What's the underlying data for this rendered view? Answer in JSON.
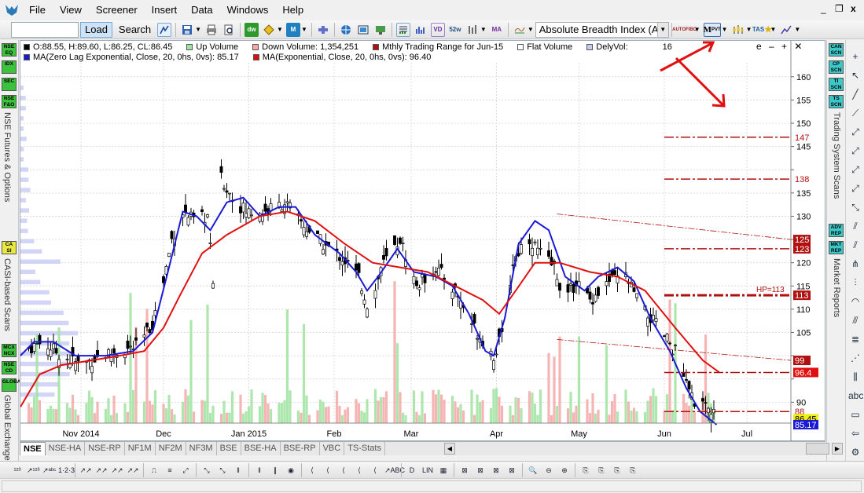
{
  "menu": {
    "items": [
      "File",
      "View",
      "Screener",
      "Insert",
      "Data",
      "Windows",
      "Help"
    ],
    "minimize": "_",
    "restore": "❐",
    "close": "x"
  },
  "toolbar": {
    "symbol_value": "",
    "load_label": "Load",
    "search_label": "Search",
    "indicator_value": "Absolute Breadth Index (ABI",
    "icons": {
      "dw": "dw",
      "s52": "52w",
      "hilo": "HiLo",
      "ma": "MA",
      "auto": "AUTO",
      "fibo": "FIBO",
      "mpvt_m": "M",
      "mpvt": "PVT",
      "tas": "TAS"
    }
  },
  "left_panel": {
    "badges": [
      "NSE EQ",
      "IDX",
      "SEC",
      "NSE F&O",
      "CA SI",
      "MCX NCX",
      "NSE CD",
      "GLOBAL"
    ],
    "labels": [
      "NSE Futures & Options",
      "CASI-based Scans",
      "Global Exchange"
    ]
  },
  "right_panel": {
    "badges": [
      "CAN SCN",
      "CP SCN",
      "TI SCN",
      "TS SCN",
      "ADV REP",
      "MKT REP"
    ],
    "labels": [
      "Trading System Scans",
      "Market Reports"
    ]
  },
  "legend": {
    "ohlc": "O:88.55, H:89.60, L:86.25, CL:86.45",
    "up_volume": "Up Volume",
    "down_volume": "Down Volume: 1,354,251",
    "monthly_range": "Mthly Trading Range for Jun-15",
    "flat_volume": "Flat Volume",
    "dely_vol": "DelyVol:",
    "dely_vol_value": "16",
    "ma1": "MA(Zero Lag Exponential, Close, 20, 0hs, 0vs): 85.17",
    "ma2": "MA(Exponential, Close, 20, 0hs, 0vs): 96.40",
    "controls": "e – + ✕"
  },
  "colors": {
    "candle": "#000000",
    "ma_blue": "#1a1ad6",
    "ma_red": "#e01010",
    "level_line": "#b01010",
    "up_vol": "#9fe39f",
    "down_vol": "#f4a8a8",
    "vap": "#c8caf4",
    "badge_green": "#3cc23c",
    "badge_cyan": "#3cc8c8",
    "badge_yellow": "#e8e840",
    "price_tag_bg": "#b01010",
    "close_tag_bg": "#f2ee10",
    "zl_tag_bg": "#1a1ad6"
  },
  "chart_data": {
    "type": "candlestick",
    "title": "",
    "y_ticks": [
      90,
      95,
      100,
      105,
      110,
      115,
      120,
      125,
      130,
      135,
      140,
      145,
      150,
      155,
      160
    ],
    "y_tick_labels_shown": [
      "90",
      "",
      "",
      "105",
      "110",
      "115",
      "120",
      "125",
      "130",
      "135",
      "",
      "145",
      "150",
      "155",
      "160"
    ],
    "ylim": [
      85.5,
      163
    ],
    "x_labels": [
      "Nov 2014",
      "Dec",
      "Jan 2015",
      "Feb",
      "Mar",
      "Apr",
      "May",
      "Jun",
      "Jul"
    ],
    "x_label_dates": [
      "2014-11-01",
      "2014-12-01",
      "2015-01-01",
      "2015-02-01",
      "2015-03-01",
      "2015-04-01",
      "2015-05-01",
      "2015-06-01",
      "2015-07-01"
    ],
    "xlim": [
      "2014-10-10",
      "2015-07-17"
    ],
    "close_path": [
      [
        "2014-10-11",
        101
      ],
      [
        "2014-10-18",
        103
      ],
      [
        "2014-10-25",
        100
      ],
      [
        "2014-11-01",
        98
      ],
      [
        "2014-11-08",
        100
      ],
      [
        "2014-11-15",
        101
      ],
      [
        "2014-11-22",
        102
      ],
      [
        "2014-11-27",
        107
      ],
      [
        "2014-12-01",
        116
      ],
      [
        "2014-12-04",
        125
      ],
      [
        "2014-12-08",
        131
      ],
      [
        "2014-12-12",
        129
      ],
      [
        "2014-12-17",
        130
      ],
      [
        "2014-12-19",
        116
      ],
      [
        "2014-12-22",
        138
      ],
      [
        "2014-12-26",
        134
      ],
      [
        "2014-12-31",
        131
      ],
      [
        "2015-01-07",
        131
      ],
      [
        "2015-01-14",
        133
      ],
      [
        "2015-01-21",
        128
      ],
      [
        "2015-01-28",
        124
      ],
      [
        "2015-02-04",
        121
      ],
      [
        "2015-02-10",
        117
      ],
      [
        "2015-02-14",
        109
      ],
      [
        "2015-02-18",
        119
      ],
      [
        "2015-02-25",
        125
      ],
      [
        "2015-03-03",
        115
      ],
      [
        "2015-03-10",
        119
      ],
      [
        "2015-03-17",
        114
      ],
      [
        "2015-03-24",
        106
      ],
      [
        "2015-03-31",
        100
      ],
      [
        "2015-04-03",
        104
      ],
      [
        "2015-04-07",
        120
      ],
      [
        "2015-04-12",
        126
      ],
      [
        "2015-04-17",
        122
      ],
      [
        "2015-04-22",
        119
      ],
      [
        "2015-04-26",
        112
      ],
      [
        "2015-04-30",
        116
      ],
      [
        "2015-05-05",
        112
      ],
      [
        "2015-05-12",
        116
      ],
      [
        "2015-05-18",
        117
      ],
      [
        "2015-05-24",
        110
      ],
      [
        "2015-05-30",
        106
      ],
      [
        "2015-06-05",
        101
      ],
      [
        "2015-06-10",
        92
      ],
      [
        "2015-06-14",
        89
      ],
      [
        "2015-06-18",
        88
      ],
      [
        "2015-06-21",
        86.45
      ]
    ],
    "series": [
      {
        "name": "MA(Zero Lag Exponential, Close, 20, 0hs, 0vs)",
        "last": 85.17,
        "points": [
          [
            "2014-10-10",
            100
          ],
          [
            "2014-10-15",
            103
          ],
          [
            "2014-10-22",
            103
          ],
          [
            "2014-10-30",
            100
          ],
          [
            "2014-11-10",
            100
          ],
          [
            "2014-11-20",
            101
          ],
          [
            "2014-11-27",
            105
          ],
          [
            "2014-12-03",
            119
          ],
          [
            "2014-12-08",
            131
          ],
          [
            "2014-12-13",
            130
          ],
          [
            "2014-12-18",
            127
          ],
          [
            "2014-12-24",
            133
          ],
          [
            "2014-12-30",
            134
          ],
          [
            "2015-01-05",
            130
          ],
          [
            "2015-01-12",
            132
          ],
          [
            "2015-01-18",
            132
          ],
          [
            "2015-01-25",
            126
          ],
          [
            "2015-02-03",
            122
          ],
          [
            "2015-02-09",
            118
          ],
          [
            "2015-02-13",
            114
          ],
          [
            "2015-02-17",
            117
          ],
          [
            "2015-02-24",
            123
          ],
          [
            "2015-03-02",
            118
          ],
          [
            "2015-03-10",
            117
          ],
          [
            "2015-03-16",
            115
          ],
          [
            "2015-03-22",
            109
          ],
          [
            "2015-03-28",
            101
          ],
          [
            "2015-03-31",
            100
          ],
          [
            "2015-04-04",
            108
          ],
          [
            "2015-04-09",
            124
          ],
          [
            "2015-04-15",
            129
          ],
          [
            "2015-04-20",
            127
          ],
          [
            "2015-04-26",
            117
          ],
          [
            "2015-05-03",
            114
          ],
          [
            "2015-05-08",
            117
          ],
          [
            "2015-05-15",
            119
          ],
          [
            "2015-05-21",
            116
          ],
          [
            "2015-05-27",
            108
          ],
          [
            "2015-06-03",
            101
          ],
          [
            "2015-06-09",
            93
          ],
          [
            "2015-06-14",
            88
          ],
          [
            "2015-06-20",
            85.17
          ]
        ]
      },
      {
        "name": "MA(Exponential, Close, 20, 0hs, 0vs)",
        "last": 96.4,
        "points": [
          [
            "2014-10-10",
            89
          ],
          [
            "2014-10-17",
            96
          ],
          [
            "2014-10-25",
            98
          ],
          [
            "2014-11-05",
            99
          ],
          [
            "2014-11-15",
            100
          ],
          [
            "2014-11-24",
            101
          ],
          [
            "2014-12-01",
            106
          ],
          [
            "2014-12-07",
            113
          ],
          [
            "2014-12-15",
            122
          ],
          [
            "2014-12-24",
            126
          ],
          [
            "2015-01-05",
            130
          ],
          [
            "2015-01-15",
            131
          ],
          [
            "2015-01-25",
            129
          ],
          [
            "2015-02-05",
            124
          ],
          [
            "2015-02-15",
            120
          ],
          [
            "2015-02-25",
            119
          ],
          [
            "2015-03-07",
            118
          ],
          [
            "2015-03-17",
            115
          ],
          [
            "2015-03-27",
            112
          ],
          [
            "2015-04-02",
            109
          ],
          [
            "2015-04-08",
            114
          ],
          [
            "2015-04-15",
            120
          ],
          [
            "2015-04-24",
            120
          ],
          [
            "2015-05-05",
            118
          ],
          [
            "2015-05-15",
            117
          ],
          [
            "2015-05-25",
            114
          ],
          [
            "2015-06-05",
            106
          ],
          [
            "2015-06-15",
            99
          ],
          [
            "2015-06-21",
            96.4
          ]
        ]
      }
    ],
    "level_lines": [
      {
        "label": "147",
        "value": 147,
        "from": "2015-06-01",
        "style": "dash-dot"
      },
      {
        "label": "138",
        "value": 138,
        "from": "2015-06-01",
        "style": "dash-dot"
      },
      {
        "label": "123",
        "value": 123,
        "from": "2015-06-01",
        "style": "dash-dot"
      },
      {
        "label": "HP=113",
        "value": 113,
        "from": "2015-06-01",
        "style": "dash-dot-thick"
      },
      {
        "label": "99",
        "value": 96.4,
        "from": "2015-06-01",
        "style": "dash-dot"
      },
      {
        "label": "88",
        "value": 88,
        "from": "2015-06-01",
        "style": "dash-dot"
      }
    ],
    "trend_lines": [
      {
        "from": [
          "2015-04-23",
          130.5
        ],
        "to": [
          "2015-07-17",
          125
        ],
        "label": "125"
      },
      {
        "from": [
          "2015-04-23",
          103.5
        ],
        "to": [
          "2015-07-17",
          99
        ],
        "label": "99"
      }
    ],
    "price_tags": [
      {
        "value": "125",
        "y": 125,
        "kind": "level"
      },
      {
        "value": "123",
        "y": 123,
        "kind": "level"
      },
      {
        "value": "113",
        "y": 113,
        "kind": "level"
      },
      {
        "value": "99",
        "y": 99,
        "kind": "level"
      },
      {
        "value": "96.4",
        "y": 96.4,
        "kind": "ma-red"
      },
      {
        "value": "147",
        "y": 147,
        "kind": "text"
      },
      {
        "value": "138",
        "y": 138,
        "kind": "text"
      },
      {
        "value": "88",
        "y": 88,
        "kind": "text"
      },
      {
        "value": "86.45",
        "y": 86.45,
        "kind": "close"
      },
      {
        "value": "85.17",
        "y": 85.17,
        "kind": "ma-blue"
      }
    ],
    "grid": true,
    "volume_subpane": true,
    "volume_at_price": true,
    "legend_position": "top-left"
  },
  "bottom_tabs": {
    "items": [
      "NSE",
      "NSE-HA",
      "NSE-RP",
      "NF1M",
      "NF2M",
      "NF3M",
      "BSE",
      "BSE-HA",
      "BSE-RP",
      "VBC",
      "TS-Stats"
    ],
    "active": "NSE"
  },
  "bottom_toolbar": {
    "icons": [
      "¹²³",
      "↗¹²³",
      "↗ᵃᵇᶜ",
      "1·2·3",
      "↗↗",
      "↗↗",
      "↗↗",
      "↗↗",
      "⎍",
      "≡",
      "⤢",
      "⤡",
      "⤡",
      "‖",
      "‖",
      "❙",
      "◉",
      "⟨",
      "⟨",
      "⟨",
      "⟨",
      "⟨",
      "↗ABC",
      "D",
      "LIN",
      "▦",
      "⊠",
      "⊠",
      "⊠",
      "⊠",
      "🔍",
      "⊖",
      "⊕",
      "⎘",
      "⎘",
      "⎘",
      "⎘"
    ]
  }
}
